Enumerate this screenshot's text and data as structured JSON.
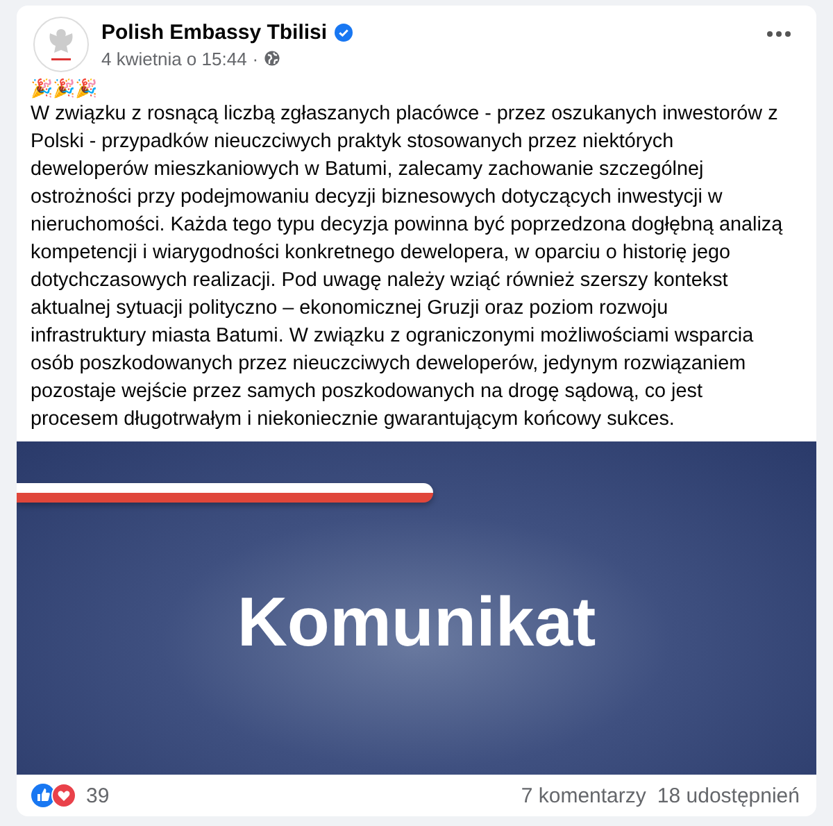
{
  "post": {
    "author": "Polish Embassy Tbilisi",
    "verified": true,
    "time": "4 kwietnia o 15:44",
    "separator": "·",
    "emoji": "🎉🎉🎉",
    "text": "W związku z rosnącą liczbą zgłaszanych placówce - przez oszukanych inwestorów z Polski - przypadków nieuczciwych praktyk stosowanych przez niektórych deweloperów mieszkaniowych w Batumi, zalecamy zachowanie szczególnej ostrożności przy podejmowaniu decyzji biznesowych dotyczących inwestycji w nieruchomości. Każda tego typu decyzja powinna być poprzedzona dogłębną analizą kompetencji i wiarygodności konkretnego dewelopera, w oparciu o historię jego dotychczasowych realizacji. Pod uwagę należy wziąć również szerszy kontekst aktualnej sytuacji polityczno – ekonomicznej Gruzji oraz poziom rozwoju infrastruktury miasta Batumi. W związku z ograniczonymi możliwościami wsparcia osób poszkodowanych przez nieuczciwych deweloperów, jedynym rozwiązaniem pozostaje wejście przez samych poszkodowanych na drogę sądową, co jest procesem długotrwałym i niekoniecznie gwarantującym końcowy sukces.",
    "graphic_title": "Komunikat"
  },
  "footer": {
    "reactions": "39",
    "comments": "7 komentarzy",
    "shares": "18 udostępnień"
  }
}
